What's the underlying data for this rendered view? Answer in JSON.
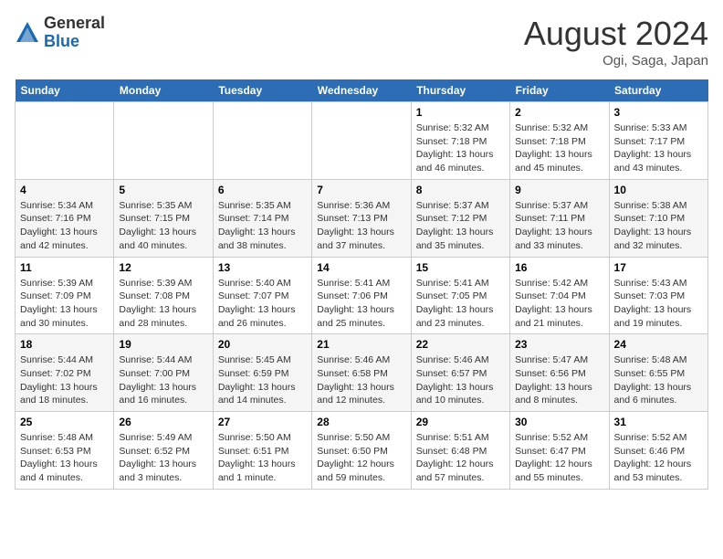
{
  "header": {
    "logo_general": "General",
    "logo_blue": "Blue",
    "month_title": "August 2024",
    "location": "Ogi, Saga, Japan"
  },
  "weekdays": [
    "Sunday",
    "Monday",
    "Tuesday",
    "Wednesday",
    "Thursday",
    "Friday",
    "Saturday"
  ],
  "weeks": [
    [
      {
        "day": "",
        "info": ""
      },
      {
        "day": "",
        "info": ""
      },
      {
        "day": "",
        "info": ""
      },
      {
        "day": "",
        "info": ""
      },
      {
        "day": "1",
        "info": "Sunrise: 5:32 AM\nSunset: 7:18 PM\nDaylight: 13 hours\nand 46 minutes."
      },
      {
        "day": "2",
        "info": "Sunrise: 5:32 AM\nSunset: 7:18 PM\nDaylight: 13 hours\nand 45 minutes."
      },
      {
        "day": "3",
        "info": "Sunrise: 5:33 AM\nSunset: 7:17 PM\nDaylight: 13 hours\nand 43 minutes."
      }
    ],
    [
      {
        "day": "4",
        "info": "Sunrise: 5:34 AM\nSunset: 7:16 PM\nDaylight: 13 hours\nand 42 minutes."
      },
      {
        "day": "5",
        "info": "Sunrise: 5:35 AM\nSunset: 7:15 PM\nDaylight: 13 hours\nand 40 minutes."
      },
      {
        "day": "6",
        "info": "Sunrise: 5:35 AM\nSunset: 7:14 PM\nDaylight: 13 hours\nand 38 minutes."
      },
      {
        "day": "7",
        "info": "Sunrise: 5:36 AM\nSunset: 7:13 PM\nDaylight: 13 hours\nand 37 minutes."
      },
      {
        "day": "8",
        "info": "Sunrise: 5:37 AM\nSunset: 7:12 PM\nDaylight: 13 hours\nand 35 minutes."
      },
      {
        "day": "9",
        "info": "Sunrise: 5:37 AM\nSunset: 7:11 PM\nDaylight: 13 hours\nand 33 minutes."
      },
      {
        "day": "10",
        "info": "Sunrise: 5:38 AM\nSunset: 7:10 PM\nDaylight: 13 hours\nand 32 minutes."
      }
    ],
    [
      {
        "day": "11",
        "info": "Sunrise: 5:39 AM\nSunset: 7:09 PM\nDaylight: 13 hours\nand 30 minutes."
      },
      {
        "day": "12",
        "info": "Sunrise: 5:39 AM\nSunset: 7:08 PM\nDaylight: 13 hours\nand 28 minutes."
      },
      {
        "day": "13",
        "info": "Sunrise: 5:40 AM\nSunset: 7:07 PM\nDaylight: 13 hours\nand 26 minutes."
      },
      {
        "day": "14",
        "info": "Sunrise: 5:41 AM\nSunset: 7:06 PM\nDaylight: 13 hours\nand 25 minutes."
      },
      {
        "day": "15",
        "info": "Sunrise: 5:41 AM\nSunset: 7:05 PM\nDaylight: 13 hours\nand 23 minutes."
      },
      {
        "day": "16",
        "info": "Sunrise: 5:42 AM\nSunset: 7:04 PM\nDaylight: 13 hours\nand 21 minutes."
      },
      {
        "day": "17",
        "info": "Sunrise: 5:43 AM\nSunset: 7:03 PM\nDaylight: 13 hours\nand 19 minutes."
      }
    ],
    [
      {
        "day": "18",
        "info": "Sunrise: 5:44 AM\nSunset: 7:02 PM\nDaylight: 13 hours\nand 18 minutes."
      },
      {
        "day": "19",
        "info": "Sunrise: 5:44 AM\nSunset: 7:00 PM\nDaylight: 13 hours\nand 16 minutes."
      },
      {
        "day": "20",
        "info": "Sunrise: 5:45 AM\nSunset: 6:59 PM\nDaylight: 13 hours\nand 14 minutes."
      },
      {
        "day": "21",
        "info": "Sunrise: 5:46 AM\nSunset: 6:58 PM\nDaylight: 13 hours\nand 12 minutes."
      },
      {
        "day": "22",
        "info": "Sunrise: 5:46 AM\nSunset: 6:57 PM\nDaylight: 13 hours\nand 10 minutes."
      },
      {
        "day": "23",
        "info": "Sunrise: 5:47 AM\nSunset: 6:56 PM\nDaylight: 13 hours\nand 8 minutes."
      },
      {
        "day": "24",
        "info": "Sunrise: 5:48 AM\nSunset: 6:55 PM\nDaylight: 13 hours\nand 6 minutes."
      }
    ],
    [
      {
        "day": "25",
        "info": "Sunrise: 5:48 AM\nSunset: 6:53 PM\nDaylight: 13 hours\nand 4 minutes."
      },
      {
        "day": "26",
        "info": "Sunrise: 5:49 AM\nSunset: 6:52 PM\nDaylight: 13 hours\nand 3 minutes."
      },
      {
        "day": "27",
        "info": "Sunrise: 5:50 AM\nSunset: 6:51 PM\nDaylight: 13 hours\nand 1 minute."
      },
      {
        "day": "28",
        "info": "Sunrise: 5:50 AM\nSunset: 6:50 PM\nDaylight: 12 hours\nand 59 minutes."
      },
      {
        "day": "29",
        "info": "Sunrise: 5:51 AM\nSunset: 6:48 PM\nDaylight: 12 hours\nand 57 minutes."
      },
      {
        "day": "30",
        "info": "Sunrise: 5:52 AM\nSunset: 6:47 PM\nDaylight: 12 hours\nand 55 minutes."
      },
      {
        "day": "31",
        "info": "Sunrise: 5:52 AM\nSunset: 6:46 PM\nDaylight: 12 hours\nand 53 minutes."
      }
    ]
  ]
}
